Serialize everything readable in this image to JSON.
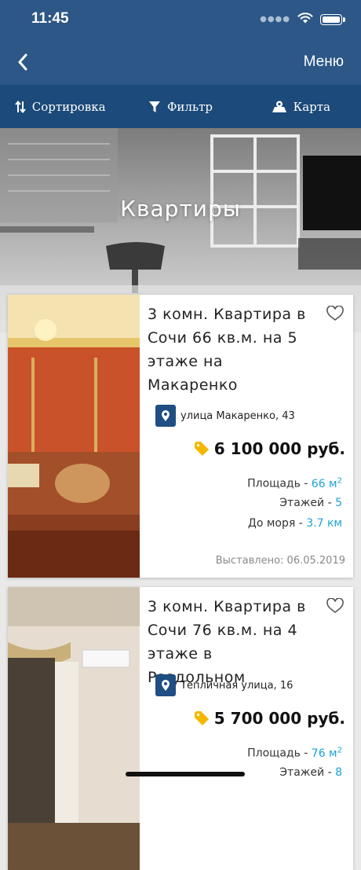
{
  "status": {
    "time": "11:45"
  },
  "nav": {
    "menu_label": "Меню"
  },
  "toolbar": {
    "sort_label": "Сортировка",
    "filter_label": "Фильтр",
    "map_label": "Карта"
  },
  "hero": {
    "title": "Квартиры"
  },
  "listings": [
    {
      "title": "3 комн. Квартира в Сочи 66 кв.м. на 5 этаже на Макаренко",
      "address": "улица Макаренко, 43",
      "price": "6 100 000 руб.",
      "area_label": "Площадь - ",
      "area_value": "66 м",
      "area_sup": "2",
      "floor_label": "Этажей - ",
      "floor_value": "5",
      "sea_label": "До моря - ",
      "sea_value": "3.7 км",
      "posted": "Выставлено: 06.05.2019"
    },
    {
      "title": "3 комн. Квартира в Сочи 76 кв.м. на 4 этаже в Раздольном",
      "address": "Тепличная улица, 16",
      "price": "5 700 000 руб.",
      "area_label": "Площадь - ",
      "area_value": "76 м",
      "area_sup": "2",
      "floor_label": "Этажей - ",
      "floor_value": "8"
    }
  ],
  "colors": {
    "nav_bg": "#2c5786",
    "toolbar_bg": "#1c4a7a",
    "accent_value": "#1aa3d9",
    "tag": "#f5b800"
  }
}
